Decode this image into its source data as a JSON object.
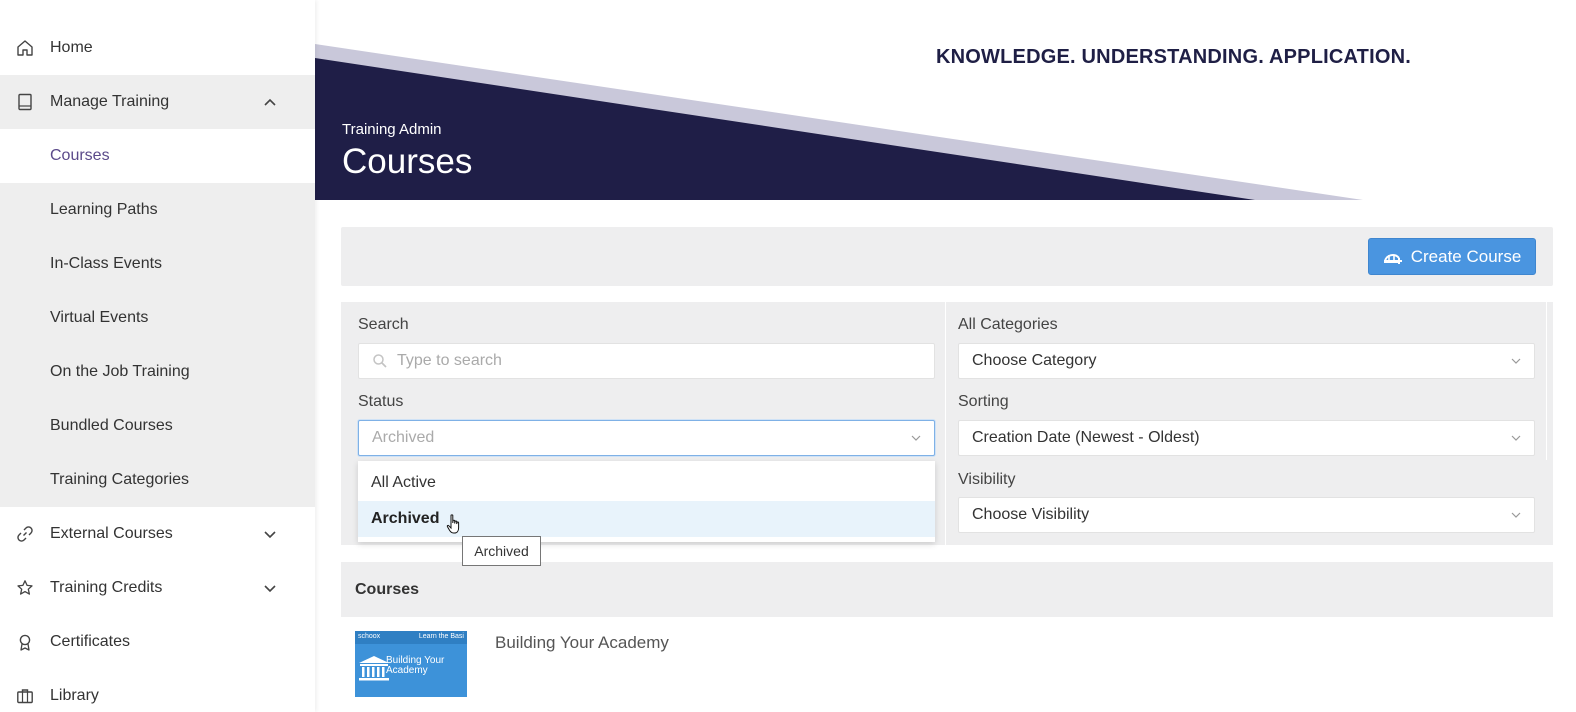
{
  "sidebar": {
    "home": "Home",
    "manage_training": "Manage Training",
    "sub_items": [
      {
        "label": "Courses"
      },
      {
        "label": "Learning Paths"
      },
      {
        "label": "In-Class Events"
      },
      {
        "label": "Virtual Events"
      },
      {
        "label": "On the Job Training"
      },
      {
        "label": "Bundled Courses"
      },
      {
        "label": "Training Categories"
      }
    ],
    "external_courses": "External Courses",
    "training_credits": "Training Credits",
    "certificates": "Certificates",
    "library": "Library"
  },
  "header": {
    "tagline": "KNOWLEDGE. UNDERSTANDING. APPLICATION.",
    "subtitle": "Training Admin",
    "title": "Courses",
    "colors": {
      "banner": "#1f1e47",
      "stripe": "#c9c8da"
    }
  },
  "toolbar": {
    "create_label": "Create Course",
    "accent": "#4a95e0"
  },
  "filters": {
    "search_label": "Search",
    "search_placeholder": "Type to search",
    "status_label": "Status",
    "status_value": "Archived",
    "status_options": [
      {
        "label": "All Active"
      },
      {
        "label": "Archived"
      }
    ],
    "category_label": "All Categories",
    "category_value": "Choose Category",
    "sorting_label": "Sorting",
    "sorting_value": "Creation Date (Newest - Oldest)",
    "visibility_label": "Visibility",
    "visibility_value": "Choose Visibility"
  },
  "tooltip": "Archived",
  "courses": {
    "heading": "Courses",
    "items": [
      {
        "title": "Building Your Academy",
        "thumb_text": "Building Your Academy",
        "thumb_tag": "Learn the Basi",
        "thumb_brand": "schoox"
      }
    ]
  }
}
